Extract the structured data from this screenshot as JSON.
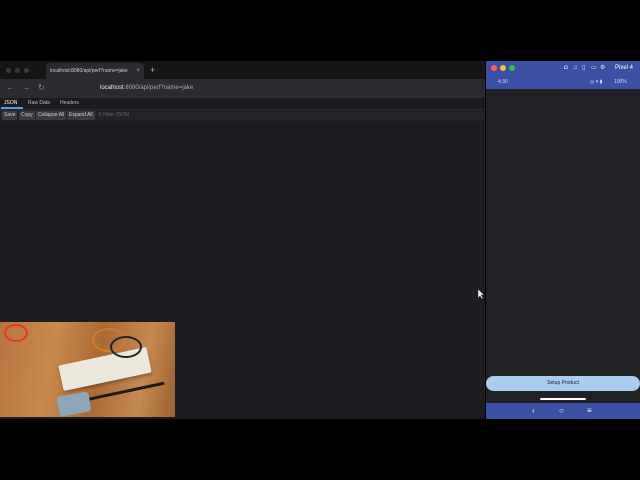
{
  "browser": {
    "tab_title": "localhost:8080/api/perf?name=jake",
    "tab_close": "×",
    "new_tab": "+",
    "nav": {
      "back": "←",
      "forward": "→",
      "reload": "↻"
    },
    "url_host": "localhost",
    "url_rest": ":8080/api/perf?name=jake",
    "viewer_tabs": [
      "JSON",
      "Raw Data",
      "Headers"
    ],
    "toolbar": {
      "save": "Save",
      "copy": "Copy",
      "collapse": "Collapse All",
      "expand": "Expand All",
      "filter": "Filter JSON"
    }
  },
  "emulator": {
    "device": "Pixel 4",
    "status_time": "4:30",
    "status_battery": "100%",
    "setup_button": "Setup Product",
    "nav": {
      "back": "‹",
      "home": "○",
      "recents": "≡"
    },
    "colors": {
      "accent": "#3b4fa3",
      "button": "#a9cdf0"
    }
  }
}
